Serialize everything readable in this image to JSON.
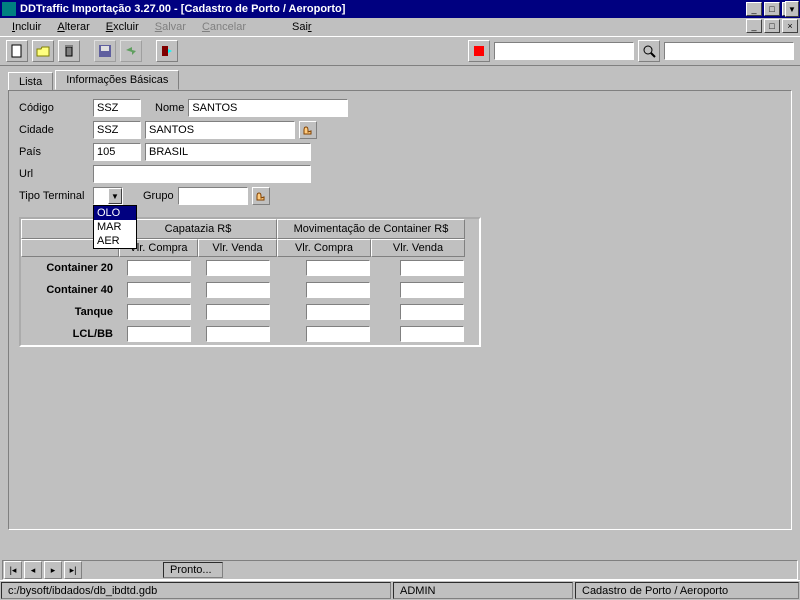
{
  "title": "DDTraffic Importação 3.27.00 - [Cadastro de Porto / Aeroporto]",
  "menu": {
    "incluir": "Incluir",
    "alterar": "Alterar",
    "excluir": "Excluir",
    "salvar": "Salvar",
    "cancelar": "Cancelar",
    "sair": "Sair"
  },
  "tabs": {
    "lista": "Lista",
    "info": "Informações Básicas"
  },
  "form": {
    "codigo_lbl": "Código",
    "codigo_val": "SSZ",
    "nome_lbl": "Nome",
    "nome_val": "SANTOS",
    "cidade_lbl": "Cidade",
    "cidade_code": "SSZ",
    "cidade_name": "SANTOS",
    "pais_lbl": "País",
    "pais_code": "105",
    "pais_name": "BRASIL",
    "url_lbl": "Url",
    "url_val": "",
    "tipo_lbl": "Tipo Terminal",
    "tipo_val": "",
    "tipo_opts": [
      "OLO",
      "MAR",
      "AER"
    ],
    "grupo_lbl": "Grupo",
    "grupo_val": ""
  },
  "grid": {
    "h1": "Capatazia R$",
    "h2": "Movimentação de Container R$",
    "compra": "Vlr. Compra",
    "venda": "Vlr. Venda",
    "rows": [
      "Container 20",
      "Container 40",
      "Tanque",
      "LCL/BB"
    ]
  },
  "nav": {
    "status": "Pronto..."
  },
  "status": {
    "path": "c:/bysoft/ibdados/db_ibdtd.gdb",
    "user": "ADMIN",
    "module": "Cadastro de Porto / Aeroporto"
  }
}
